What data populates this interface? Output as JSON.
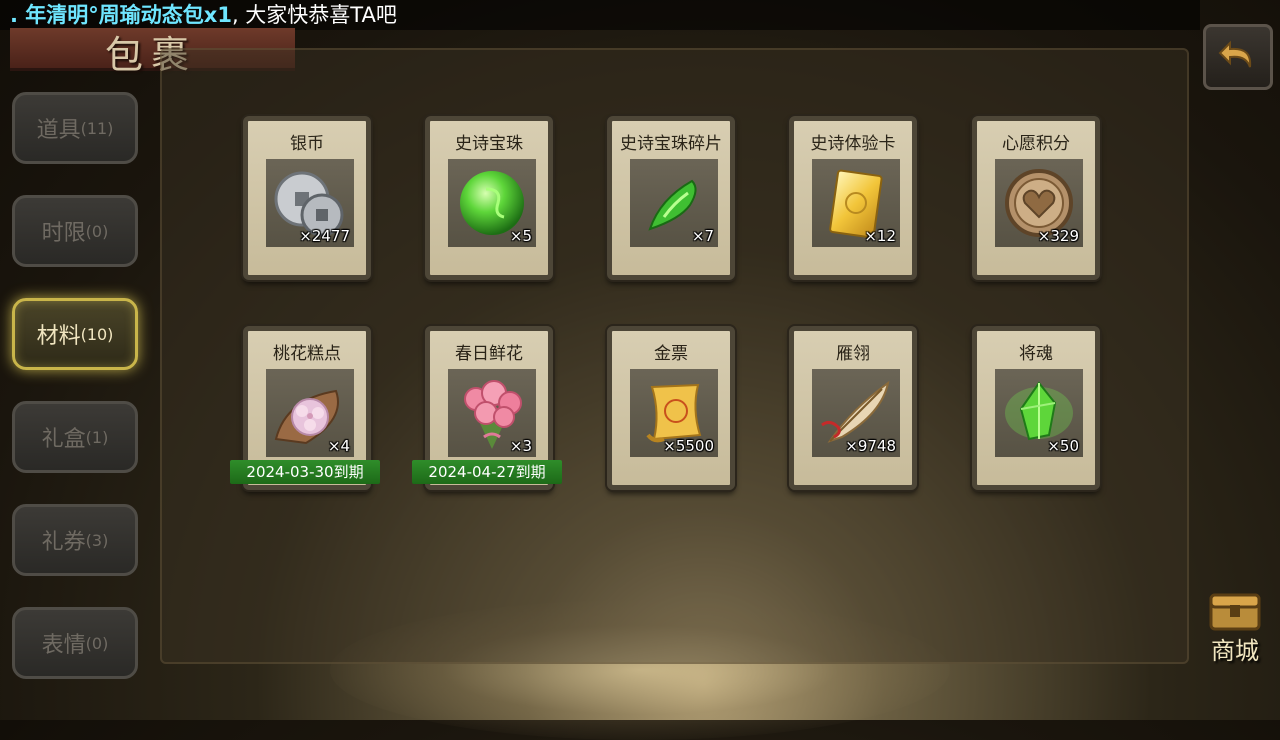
{
  "marquee": {
    "highlight": ". 年清明°周瑜动态包x1",
    "rest": ", 大家快恭喜TA吧"
  },
  "title": "包裹",
  "tabs": [
    {
      "label": "道具",
      "count": "(11)",
      "active": false
    },
    {
      "label": "时限",
      "count": "(0)",
      "active": false
    },
    {
      "label": "材料",
      "count": "(10)",
      "active": true
    },
    {
      "label": "礼盒",
      "count": "(1)",
      "active": false
    },
    {
      "label": "礼券",
      "count": "(3)",
      "active": false
    },
    {
      "label": "表情",
      "count": "(0)",
      "active": false
    }
  ],
  "items": [
    {
      "name": "银币",
      "qty": "×2477",
      "icon": "silver-coin-icon"
    },
    {
      "name": "史诗宝珠",
      "qty": "×5",
      "icon": "green-orb-icon"
    },
    {
      "name": "史诗宝珠碎片",
      "qty": "×7",
      "icon": "orb-shard-icon"
    },
    {
      "name": "史诗体验卡",
      "qty": "×12",
      "icon": "gold-card-icon"
    },
    {
      "name": "心愿积分",
      "qty": "×329",
      "icon": "heart-coin-icon"
    },
    {
      "name": "桃花糕点",
      "qty": "×4",
      "icon": "peach-cake-icon",
      "expire": "2024-03-30到期"
    },
    {
      "name": "春日鲜花",
      "qty": "×3",
      "icon": "flower-bouquet-icon",
      "expire": "2024-04-27到期"
    },
    {
      "name": "金票",
      "qty": "×5500",
      "icon": "gold-ticket-icon"
    },
    {
      "name": "雁翎",
      "qty": "×9748",
      "icon": "feather-icon"
    },
    {
      "name": "将魂",
      "qty": "×50",
      "icon": "green-crystal-icon"
    }
  ],
  "shop_label": "商城",
  "colors": {
    "active_tab_glow": "#c9b54a",
    "expire_bar": "#2f8d2a",
    "marquee_highlight": "#6fe6ff"
  }
}
